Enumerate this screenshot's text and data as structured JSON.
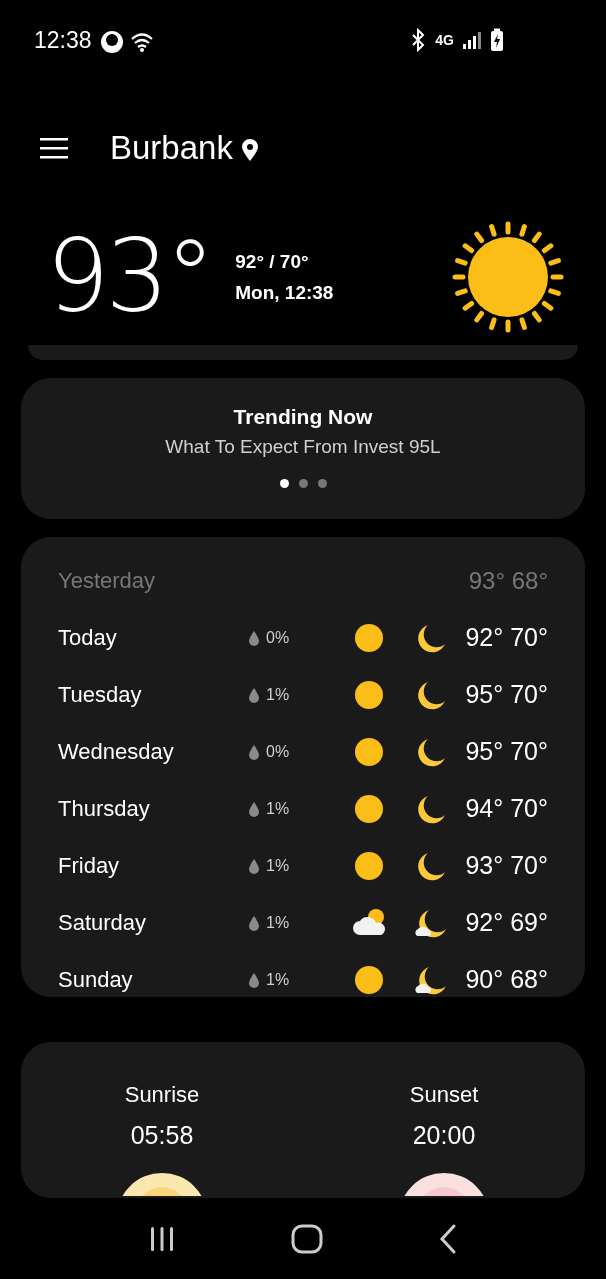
{
  "status_bar": {
    "time": "12:38",
    "network": "4G"
  },
  "header": {
    "location": "Burbank"
  },
  "current": {
    "temperature": "93°",
    "high_low": "92° / 70°",
    "updated": "Mon, 12:38",
    "icon": {
      "kind": "sun"
    }
  },
  "trending": {
    "title": "Trending Now",
    "headline": "What To Expect From Invest 95L",
    "dots": [
      {
        "selected": true
      },
      {
        "selected": false
      },
      {
        "selected": false
      }
    ]
  },
  "yesterday": {
    "label": "Yesterday",
    "temps": "93° 68°"
  },
  "forecast": [
    {
      "day": "Today",
      "precip": "0%",
      "day_icon": {
        "kind": "sun"
      },
      "night_icon": {
        "kind": "moon"
      },
      "temps": "92° 70°"
    },
    {
      "day": "Tuesday",
      "precip": "1%",
      "day_icon": {
        "kind": "sun"
      },
      "night_icon": {
        "kind": "moon"
      },
      "temps": "95° 70°"
    },
    {
      "day": "Wednesday",
      "precip": "0%",
      "day_icon": {
        "kind": "sun"
      },
      "night_icon": {
        "kind": "moon"
      },
      "temps": "95° 70°"
    },
    {
      "day": "Thursday",
      "precip": "1%",
      "day_icon": {
        "kind": "sun"
      },
      "night_icon": {
        "kind": "moon"
      },
      "temps": "94° 70°"
    },
    {
      "day": "Friday",
      "precip": "1%",
      "day_icon": {
        "kind": "sun"
      },
      "night_icon": {
        "kind": "moon"
      },
      "temps": "93° 70°"
    },
    {
      "day": "Saturday",
      "precip": "1%",
      "day_icon": {
        "kind": "cloudy"
      },
      "night_icon": {
        "kind": "cloudy-night"
      },
      "temps": "92° 69°"
    },
    {
      "day": "Sunday",
      "precip": "1%",
      "day_icon": {
        "kind": "sun"
      },
      "night_icon": {
        "kind": "cloudy-night"
      },
      "temps": "90° 68°"
    }
  ],
  "sun_times": [
    {
      "label": "Sunrise",
      "time": "05:58",
      "kind": "sunrise"
    },
    {
      "label": "Sunset",
      "time": "20:00",
      "kind": "sunset"
    }
  ]
}
